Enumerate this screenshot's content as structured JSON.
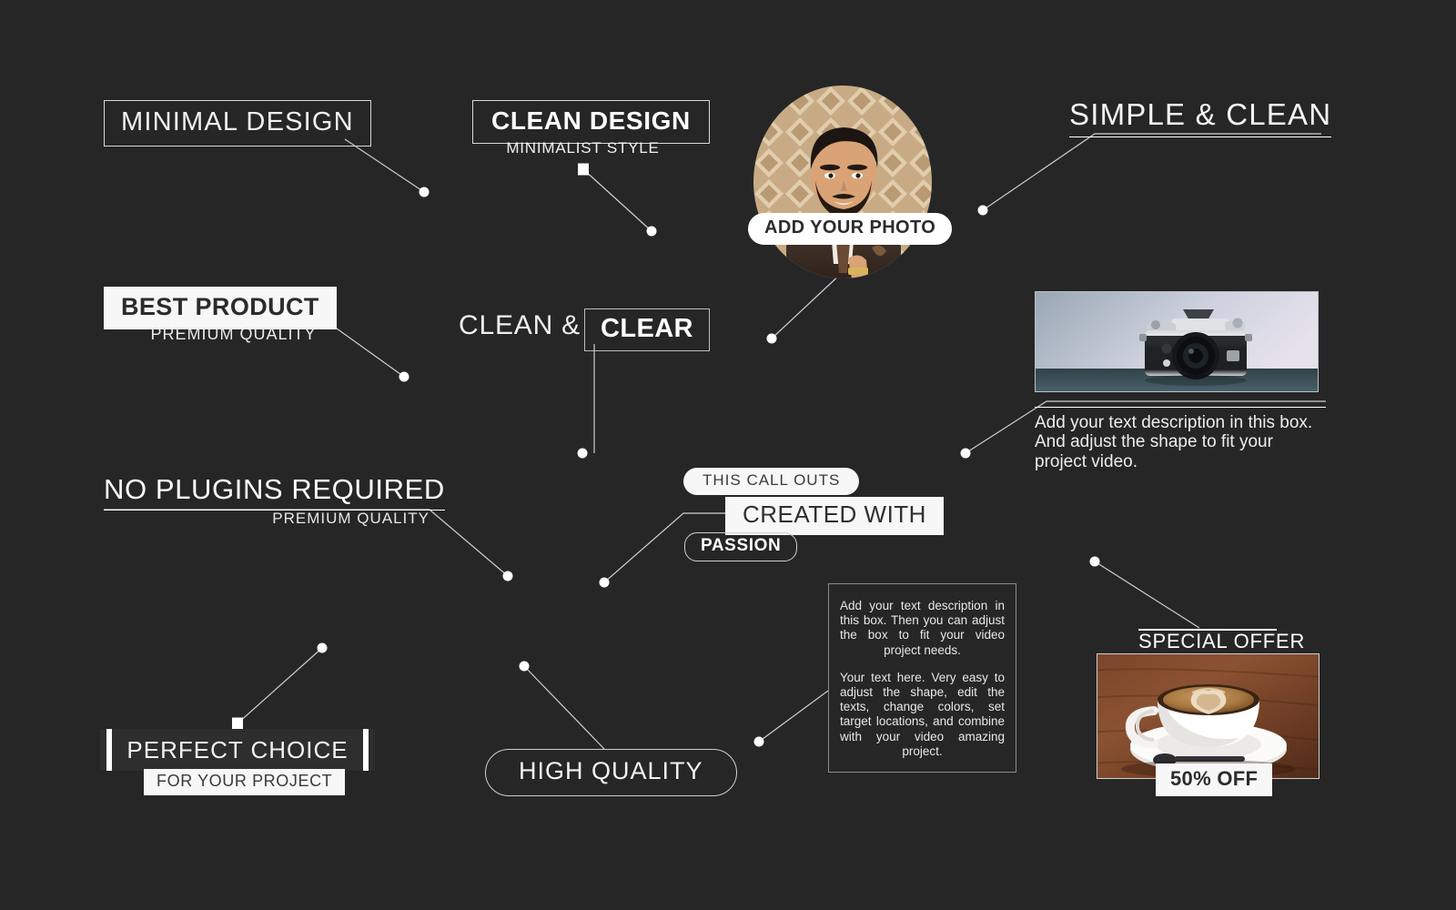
{
  "background_color": "#262626",
  "accent_white": "#ffffff",
  "left_column": {
    "minimal_design": "MINIMAL DESIGN",
    "best_product": "BEST PRODUCT",
    "best_product_sub": "PREMIUM QUALITY",
    "no_plugins": "NO PLUGINS REQUIRED",
    "no_plugins_sub": "PREMIUM QUALITY",
    "perfect_choice": "PERFECT CHOICE",
    "perfect_choice_sub": "FOR YOUR PROJECT"
  },
  "center_column": {
    "clean_design": "CLEAN DESIGN",
    "minimalist_style": "MINIMALIST STYLE",
    "clean_amp": "CLEAN &",
    "clear": "CLEAR",
    "high_quality": "HIGH QUALITY",
    "this_call_outs": "THIS CALL OUTS",
    "created_with": "CREATED WITH",
    "passion": "PASSION"
  },
  "right_column": {
    "add_your_photo": "ADD YOUR PHOTO",
    "simple_clean": "SIMPLE & CLEAN",
    "camera_description": "Add your text description in this box. And adjust the shape to fit your project video.",
    "special_offer": "SPECIAL OFFER",
    "discount_badge": "50% OFF"
  },
  "description_box": {
    "paragraph_1": "Add your text description in this box. Then you can adjust the box to fit your video project needs.",
    "paragraph_2": "Your text here. Very easy to adjust the shape, edit the texts, change colors, set target locations, and combine with your video amazing project."
  },
  "icons": {
    "portrait": "person-portrait-photo",
    "camera": "vintage-camera-photo",
    "coffee": "coffee-cup-latte-photo"
  }
}
